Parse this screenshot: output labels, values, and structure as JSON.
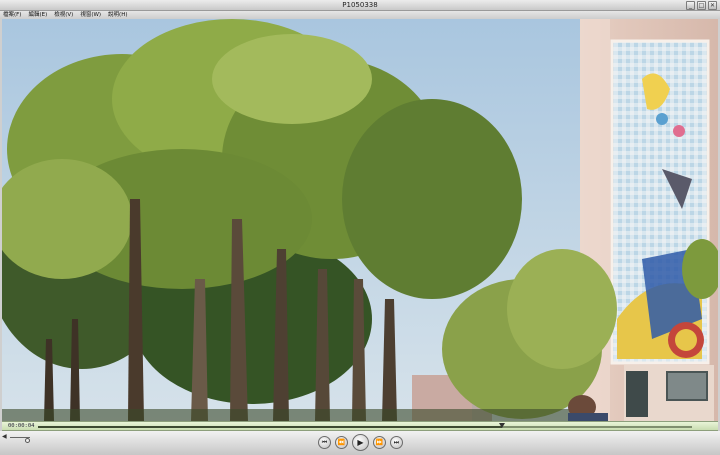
{
  "window": {
    "title": "P1050338",
    "buttons": {
      "minimize": "_",
      "maximize": "□",
      "close": "✕"
    }
  },
  "menu": {
    "items": [
      "檔案(F)",
      "編輯(E)",
      "檢視(V)",
      "視窗(W)",
      "說明(H)"
    ]
  },
  "timeline": {
    "current_time": "00:00:04",
    "progress": 0.71
  },
  "volume": {
    "level": 0.85
  },
  "transport": {
    "buttons": [
      {
        "name": "go-to-start-button",
        "icon": "skip-start-icon",
        "glyph": "⏮"
      },
      {
        "name": "rewind-button",
        "icon": "rewind-icon",
        "glyph": "⏪"
      },
      {
        "name": "play-button",
        "icon": "play-icon",
        "glyph": "▶"
      },
      {
        "name": "fast-forward-button",
        "icon": "fast-forward-icon",
        "glyph": "⏩"
      },
      {
        "name": "go-to-end-button",
        "icon": "skip-end-icon",
        "glyph": "⏭"
      }
    ]
  },
  "colors": {
    "timeline_bg": "#d9ebc4",
    "sky": "#b8d0e4",
    "foliage": "#6f8f3a"
  }
}
